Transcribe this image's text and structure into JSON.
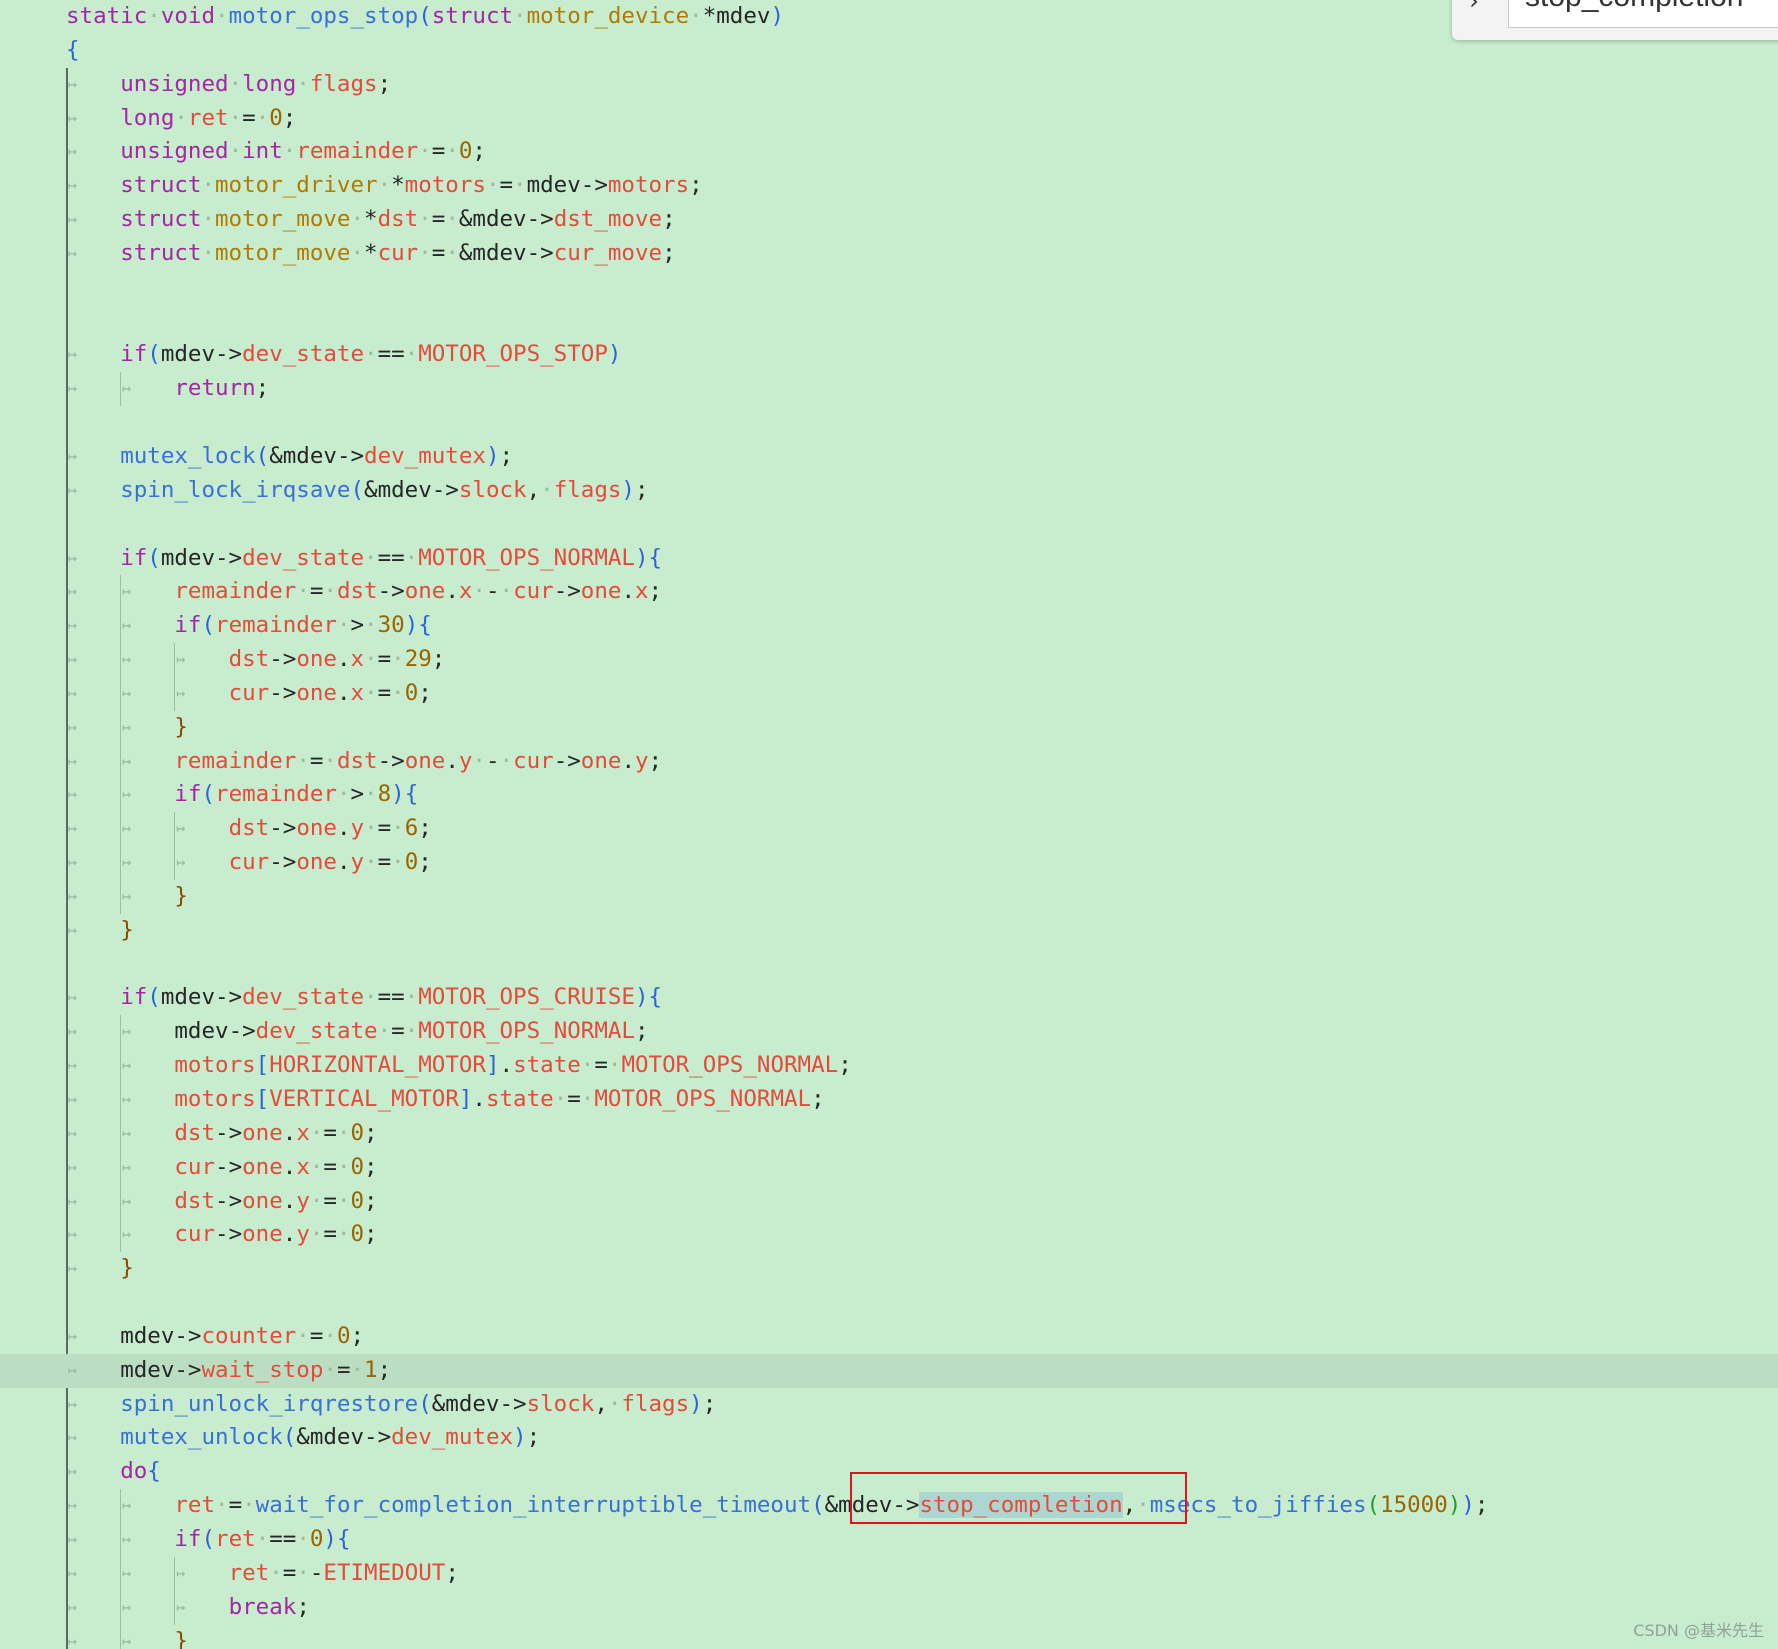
{
  "editor": {
    "background": "#c7ecce",
    "current_line_index": 40,
    "search_term_highlight": "stop_completion"
  },
  "find_widget": {
    "toggle_icon": "chevron-right-icon",
    "query": "stop_completion"
  },
  "watermark": "CSDN @基米先生",
  "colors": {
    "keyword": "#a526a4",
    "type": "#b17a00",
    "function": "#3a6fd8",
    "field": "#e54a3b",
    "number": "#9a6500",
    "annotation_box": "#e0141e"
  },
  "code_lines": [
    "static void motor_ops_stop(struct motor_device *mdev)",
    "{",
    "    unsigned long flags;",
    "    long ret = 0;",
    "    unsigned int remainder = 0;",
    "    struct motor_driver *motors = mdev->motors;",
    "    struct motor_move *dst = &mdev->dst_move;",
    "    struct motor_move *cur = &mdev->cur_move;",
    "",
    "",
    "    if(mdev->dev_state == MOTOR_OPS_STOP)",
    "        return;",
    "",
    "    mutex_lock(&mdev->dev_mutex);",
    "    spin_lock_irqsave(&mdev->slock, flags);",
    "",
    "    if(mdev->dev_state == MOTOR_OPS_NORMAL){",
    "        remainder = dst->one.x - cur->one.x;",
    "        if(remainder > 30){",
    "            dst->one.x = 29;",
    "            cur->one.x = 0;",
    "        }",
    "        remainder = dst->one.y - cur->one.y;",
    "        if(remainder > 8){",
    "            dst->one.y = 6;",
    "            cur->one.y = 0;",
    "        }",
    "    }",
    "",
    "    if(mdev->dev_state == MOTOR_OPS_CRUISE){",
    "        mdev->dev_state = MOTOR_OPS_NORMAL;",
    "        motors[HORIZONTAL_MOTOR].state = MOTOR_OPS_NORMAL;",
    "        motors[VERTICAL_MOTOR].state = MOTOR_OPS_NORMAL;",
    "        dst->one.x = 0;",
    "        cur->one.x = 0;",
    "        dst->one.y = 0;",
    "        cur->one.y = 0;",
    "    }",
    "",
    "    mdev->counter = 0;",
    "    mdev->wait_stop = 1;",
    "    spin_unlock_irqrestore(&mdev->slock, flags);",
    "    mutex_unlock(&mdev->dev_mutex);",
    "    do{",
    "        ret = wait_for_completion_interruptible_timeout(&mdev->stop_completion, msecs_to_jiffies(15000));",
    "        if(ret == 0){",
    "            ret = -ETIMEDOUT;",
    "            break;",
    "        }"
  ]
}
